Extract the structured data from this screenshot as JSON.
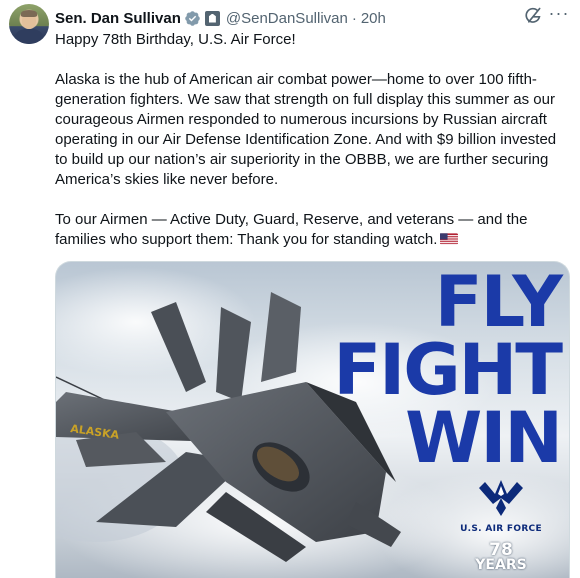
{
  "author": {
    "name": "Sen. Dan Sullivan",
    "handle": "@SenDanSullivan",
    "separator": "·",
    "time": "20h"
  },
  "icons": {
    "avatar": "profile-photo",
    "verified": "verified-badge-icon",
    "affiliation": "government-badge-icon",
    "grok": "grok-icon",
    "more": "more-icon",
    "flag": "us-flag-emoji"
  },
  "more_label": "···",
  "tweet": {
    "paragraphs": [
      "Happy 78th Birthday, U.S. Air Force!",
      "Alaska is the hub of American air combat power—home to over 100 fifth-generation fighters. We saw that strength on full display this summer as our courageous Airmen responded to numerous incursions by Russian aircraft operating in our Air Defense Identification Zone. And with $9 billion invested to build up our nation’s air superiority in the OBBB, we are further securing America’s skies like never before.",
      "To our Airmen — Active Duty, Guard, Reserve, and veterans — and the families who support them: Thank you for standing watch."
    ]
  },
  "media": {
    "slogan": [
      "FLY",
      "FIGHT",
      "WIN"
    ],
    "jet_tail_text": "ALASKA",
    "logo_label": "U.S. AIR FORCE",
    "logo_number": "78",
    "logo_years": "YEARS"
  },
  "colors": {
    "slogan_blue": "#1b3aa8",
    "verified_blue": "#1d9bf0",
    "secondary_text": "#536471"
  }
}
